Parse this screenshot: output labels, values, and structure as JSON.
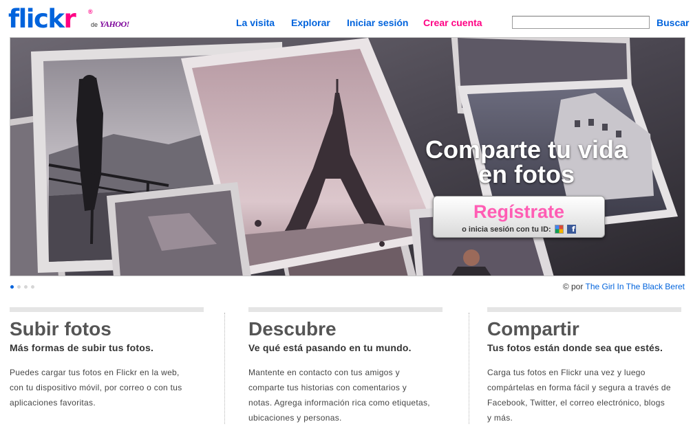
{
  "brand": {
    "logo_main": "flick",
    "logo_accent": "r",
    "logo_reg": "®",
    "logo_de": "de",
    "logo_yahoo": "YAHOO!"
  },
  "nav": [
    {
      "label": "La visita",
      "color": "#0063dc"
    },
    {
      "label": "Explorar",
      "color": "#0063dc"
    },
    {
      "label": "Iniciar sesión",
      "color": "#0063dc"
    },
    {
      "label": "Crear cuenta",
      "color": "#ff0084"
    }
  ],
  "search": {
    "value": "",
    "button_label": "Buscar"
  },
  "hero": {
    "title_line1": "Comparte tu vida",
    "title_line2": "en fotos",
    "signup_label": "Regístrate",
    "signin_text": "o inicia sesión con tu ID:",
    "identity_providers": [
      "google-icon",
      "facebook-icon"
    ]
  },
  "carousel": {
    "slides": 4,
    "active": 1
  },
  "credit": {
    "prefix": "© por",
    "author": "The Girl In The Black Beret"
  },
  "columns": [
    {
      "title": "Subir fotos",
      "subtitle": "Más formas de subir tus fotos.",
      "lines": [
        "Puedes cargar tus fotos en Flickr en la web,",
        "con tu dispositivo móvil, por correo o con tus",
        "aplicaciones favoritas."
      ]
    },
    {
      "title": "Descubre",
      "subtitle": "Ve qué está pasando en tu mundo.",
      "lines": [
        "Mantente en contacto con tus amigos y",
        "comparte tus historias con comentarios y",
        "notas. Agrega información rica como etiquetas,",
        "ubicaciones y personas."
      ]
    },
    {
      "title": "Compartir",
      "subtitle": "Tus fotos están donde sea que estés.",
      "lines": [
        "Carga tus fotos en Flickr una vez y luego",
        "compártelas en forma fácil y segura a través de",
        "Facebook, Twitter, el correo electrónico, blogs",
        "y más."
      ]
    }
  ],
  "colors": {
    "brand_blue": "#0063dc",
    "brand_pink": "#ff0084",
    "signup_pink": "#ff5db4"
  }
}
